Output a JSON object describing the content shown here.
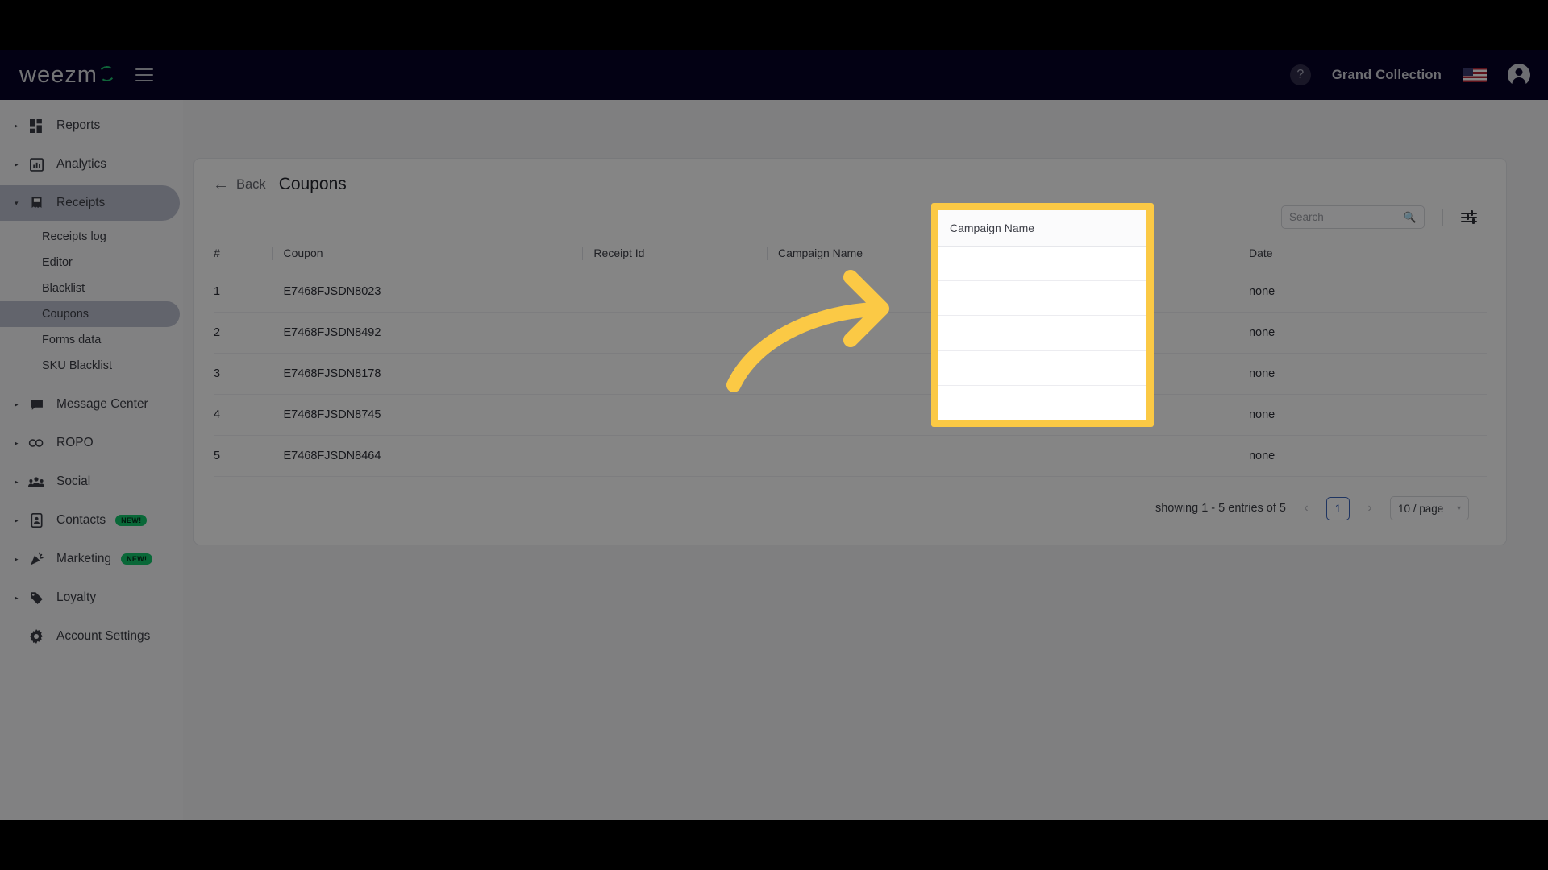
{
  "topbar": {
    "brand": "weezm",
    "menu_icon": "hamburger-icon",
    "help_label": "?",
    "account_name": "Grand Collection",
    "flag": "us-flag-icon",
    "avatar": "user-avatar-icon"
  },
  "sidebar": {
    "groups": [
      {
        "label": "Reports",
        "icon": "dashboard-icon",
        "expanded": false,
        "badge": ""
      },
      {
        "label": "Analytics",
        "icon": "bar-chart-icon",
        "expanded": false,
        "badge": ""
      },
      {
        "label": "Receipts",
        "icon": "receipt-icon",
        "expanded": true,
        "badge": ""
      },
      {
        "label": "Message Center",
        "icon": "chat-bubble-icon",
        "expanded": false,
        "badge": ""
      },
      {
        "label": "ROPO",
        "icon": "infinity-icon",
        "expanded": false,
        "badge": ""
      },
      {
        "label": "Social",
        "icon": "people-icon",
        "expanded": false,
        "badge": ""
      },
      {
        "label": "Contacts",
        "icon": "contact-card-icon",
        "expanded": false,
        "badge": "NEW!"
      },
      {
        "label": "Marketing",
        "icon": "megaphone-icon",
        "expanded": false,
        "badge": "NEW!"
      },
      {
        "label": "Loyalty",
        "icon": "tag-icon",
        "expanded": false,
        "badge": ""
      }
    ],
    "receipts_children": [
      {
        "label": "Receipts log",
        "active": false
      },
      {
        "label": "Editor",
        "active": false
      },
      {
        "label": "Blacklist",
        "active": false
      },
      {
        "label": "Coupons",
        "active": true
      },
      {
        "label": "Forms data",
        "active": false
      },
      {
        "label": "SKU Blacklist",
        "active": false
      }
    ],
    "account_settings": {
      "label": "Account Settings",
      "icon": "gear-icon"
    }
  },
  "main": {
    "back_label": "Back",
    "page_title": "Coupons",
    "search": {
      "placeholder": "Search",
      "value": ""
    },
    "filter_icon": "filter-sliders-icon",
    "table": {
      "columns": [
        "#",
        "Coupon",
        "Receipt Id",
        "Campaign Name",
        "Date"
      ],
      "rows": [
        {
          "num": "1",
          "coupon": "E7468FJSDN8023",
          "receipt_id": "",
          "campaign_name": "",
          "date": "none"
        },
        {
          "num": "2",
          "coupon": "E7468FJSDN8492",
          "receipt_id": "",
          "campaign_name": "",
          "date": "none"
        },
        {
          "num": "3",
          "coupon": "E7468FJSDN8178",
          "receipt_id": "",
          "campaign_name": "",
          "date": "none"
        },
        {
          "num": "4",
          "coupon": "E7468FJSDN8745",
          "receipt_id": "",
          "campaign_name": "",
          "date": "none"
        },
        {
          "num": "5",
          "coupon": "E7468FJSDN8464",
          "receipt_id": "",
          "campaign_name": "",
          "date": "none"
        }
      ]
    },
    "pagination": {
      "info": "showing 1 - 5 entries of 5",
      "prev": "‹",
      "current_page": "1",
      "next": "›",
      "page_size": "10 / page",
      "chevron": "⌄"
    }
  },
  "annotation": {
    "highlight_column": "Campaign Name",
    "highlight_color": "#FBC945",
    "arrow_icon": "curved-right-arrow-icon",
    "arrow_color": "#FBC945"
  },
  "colors": {
    "topbar_bg": "#070326",
    "brand_accent": "#1fbf6e",
    "sidebar_bg": "#f4f4f6",
    "active_nav": "#b9bdcc",
    "badge_green": "#12c46a",
    "page_blue": "#3a63b8"
  }
}
